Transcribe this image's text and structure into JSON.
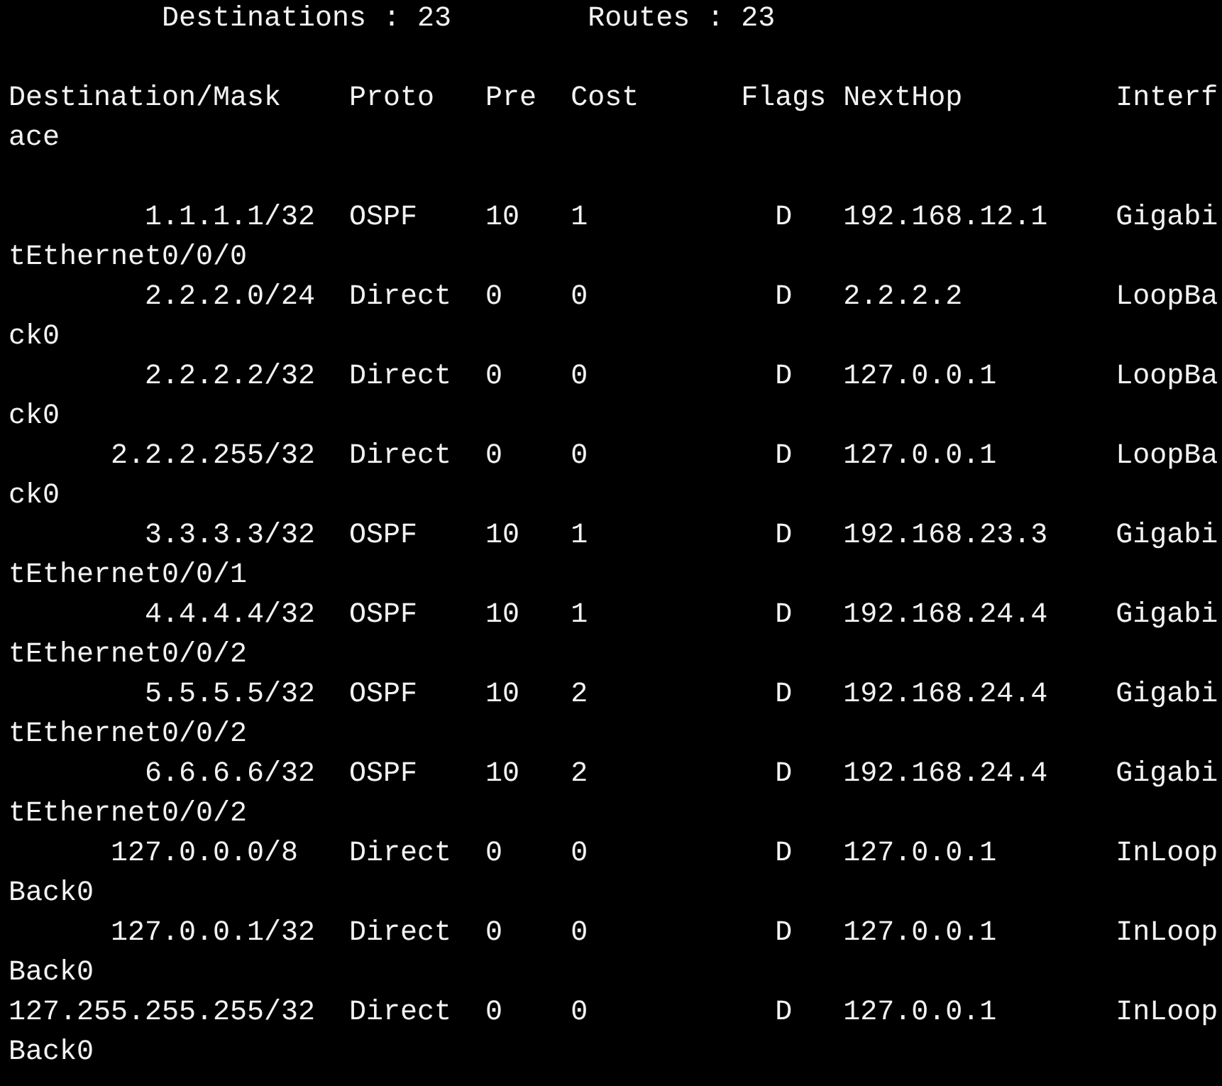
{
  "terminal": {
    "blocks": [
      [
        "         Destinations : 23        Routes : 23"
      ],
      [
        "Destination/Mask    Proto   Pre  Cost      Flags NextHop         Interf",
        "ace"
      ],
      [
        "        1.1.1.1/32  OSPF    10   1           D   192.168.12.1    Gigabi",
        "tEthernet0/0/0",
        "        2.2.2.0/24  Direct  0    0           D   2.2.2.2         LoopBa",
        "ck0",
        "        2.2.2.2/32  Direct  0    0           D   127.0.0.1       LoopBa",
        "ck0",
        "      2.2.2.255/32  Direct  0    0           D   127.0.0.1       LoopBa",
        "ck0",
        "        3.3.3.3/32  OSPF    10   1           D   192.168.23.3    Gigabi",
        "tEthernet0/0/1",
        "        4.4.4.4/32  OSPF    10   1           D   192.168.24.4    Gigabi",
        "tEthernet0/0/2",
        "        5.5.5.5/32  OSPF    10   2           D   192.168.24.4    Gigabi",
        "tEthernet0/0/2",
        "        6.6.6.6/32  OSPF    10   2           D   192.168.24.4    Gigabi",
        "tEthernet0/0/2",
        "      127.0.0.0/8   Direct  0    0           D   127.0.0.1       InLoop",
        "Back0",
        "      127.0.0.1/32  Direct  0    0           D   127.0.0.1       InLoop",
        "Back0",
        "127.255.255.255/32  Direct  0    0           D   127.0.0.1       InLoop",
        "Back0"
      ]
    ]
  }
}
